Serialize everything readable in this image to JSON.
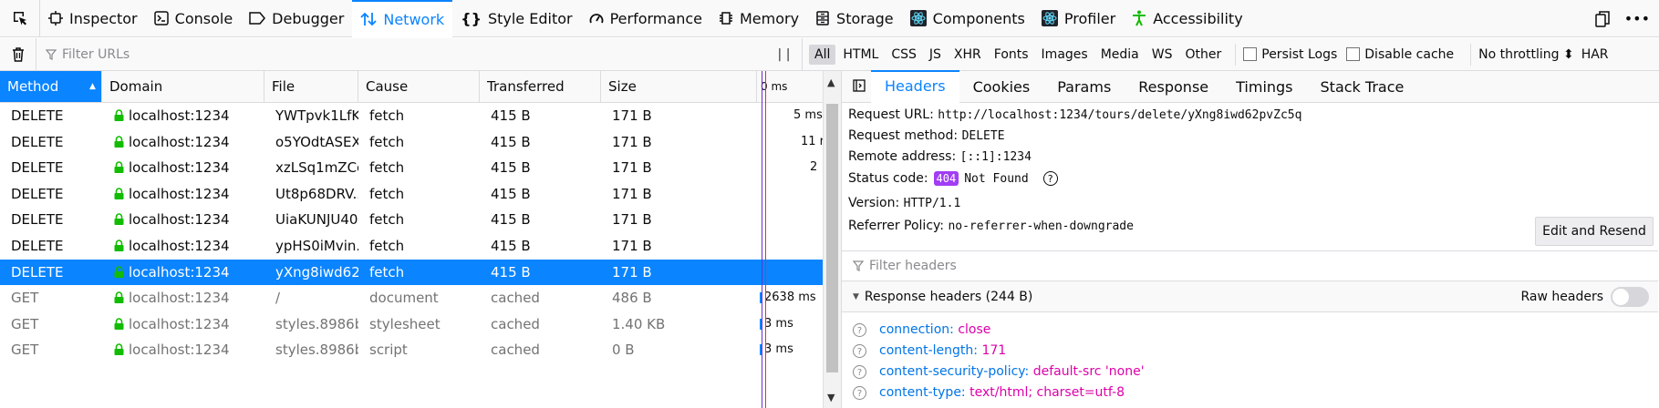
{
  "toolbar": {
    "tabs": [
      {
        "label": "Inspector"
      },
      {
        "label": "Console"
      },
      {
        "label": "Debugger"
      },
      {
        "label": "Network"
      },
      {
        "label": "Style Editor"
      },
      {
        "label": "Performance"
      },
      {
        "label": "Memory"
      },
      {
        "label": "Storage"
      },
      {
        "label": "Components"
      },
      {
        "label": "Profiler"
      },
      {
        "label": "Accessibility"
      }
    ],
    "selected_tab": "Network",
    "more_label": "•••"
  },
  "filterbar": {
    "filter_placeholder": "Filter URLs",
    "pause_label": "| |",
    "types": [
      "All",
      "HTML",
      "CSS",
      "JS",
      "XHR",
      "Fonts",
      "Images",
      "Media",
      "WS",
      "Other"
    ],
    "active_type": "All",
    "persist_logs": "Persist Logs",
    "disable_cache": "Disable cache",
    "throttling": "No throttling ⬍",
    "har": "HAR"
  },
  "table": {
    "columns": [
      "Method",
      "Domain",
      "File",
      "Cause",
      "Transferred",
      "Size"
    ],
    "waterfall_header": "0 ms",
    "rows": [
      {
        "method": "DELETE",
        "domain": "localhost:1234",
        "file": "YWTpvk1LfK...",
        "cause": "fetch",
        "transferred": "415 B",
        "size": "171 B",
        "time": "5 ms"
      },
      {
        "method": "DELETE",
        "domain": "localhost:1234",
        "file": "o5YOdtASEX...",
        "cause": "fetch",
        "transferred": "415 B",
        "size": "171 B",
        "time": "11 r"
      },
      {
        "method": "DELETE",
        "domain": "localhost:1234",
        "file": "xzLSq1mZCc...",
        "cause": "fetch",
        "transferred": "415 B",
        "size": "171 B",
        "time": "2"
      },
      {
        "method": "DELETE",
        "domain": "localhost:1234",
        "file": "Ut8p68DRV...",
        "cause": "fetch",
        "transferred": "415 B",
        "size": "171 B",
        "time": ""
      },
      {
        "method": "DELETE",
        "domain": "localhost:1234",
        "file": "UiaKUNJU40...",
        "cause": "fetch",
        "transferred": "415 B",
        "size": "171 B",
        "time": ""
      },
      {
        "method": "DELETE",
        "domain": "localhost:1234",
        "file": "ypHS0iMvin...",
        "cause": "fetch",
        "transferred": "415 B",
        "size": "171 B",
        "time": ""
      },
      {
        "method": "DELETE",
        "domain": "localhost:1234",
        "file": "yXng8iwd62...",
        "cause": "fetch",
        "transferred": "415 B",
        "size": "171 B",
        "time": ""
      },
      {
        "method": "GET",
        "domain": "localhost:1234",
        "file": "/",
        "cause": "document",
        "transferred": "cached",
        "size": "486 B",
        "time": "2638 ms"
      },
      {
        "method": "GET",
        "domain": "localhost:1234",
        "file": "styles.8986b...",
        "cause": "stylesheet",
        "transferred": "cached",
        "size": "1.40 KB",
        "time": "3 ms"
      },
      {
        "method": "GET",
        "domain": "localhost:1234",
        "file": "styles.8986b...",
        "cause": "script",
        "transferred": "cached",
        "size": "0 B",
        "time": "3 ms"
      }
    ],
    "selected_row": 6
  },
  "details": {
    "tabs": [
      "Headers",
      "Cookies",
      "Params",
      "Response",
      "Timings",
      "Stack Trace"
    ],
    "selected_tab": "Headers",
    "request_url_label": "Request URL:",
    "request_url": "http://localhost:1234/tours/delete/yXng8iwd62pvZc5q",
    "request_method_label": "Request method:",
    "request_method": "DELETE",
    "remote_address_label": "Remote address:",
    "remote_address": "[::1]:1234",
    "status_code_label": "Status code:",
    "status_code": "404",
    "status_text": "Not Found",
    "version_label": "Version:",
    "version": "HTTP/1.1",
    "referrer_label": "Referrer Policy:",
    "referrer": "no-referrer-when-downgrade",
    "edit_resend": "Edit and Resend",
    "filter_headers_placeholder": "Filter headers",
    "response_headers_title": "Response headers (244 B)",
    "raw_headers": "Raw headers",
    "response_headers": [
      {
        "name": "connection:",
        "value": "close"
      },
      {
        "name": "content-length:",
        "value": "171"
      },
      {
        "name": "content-security-policy:",
        "value": "default-src 'none'"
      },
      {
        "name": "content-type:",
        "value": "text/html; charset=utf-8"
      }
    ]
  },
  "colors": {
    "accent": "#0a84ff",
    "status_badge": "#a13df5",
    "header_name": "#0074e8",
    "header_value": "#dd00a9"
  }
}
